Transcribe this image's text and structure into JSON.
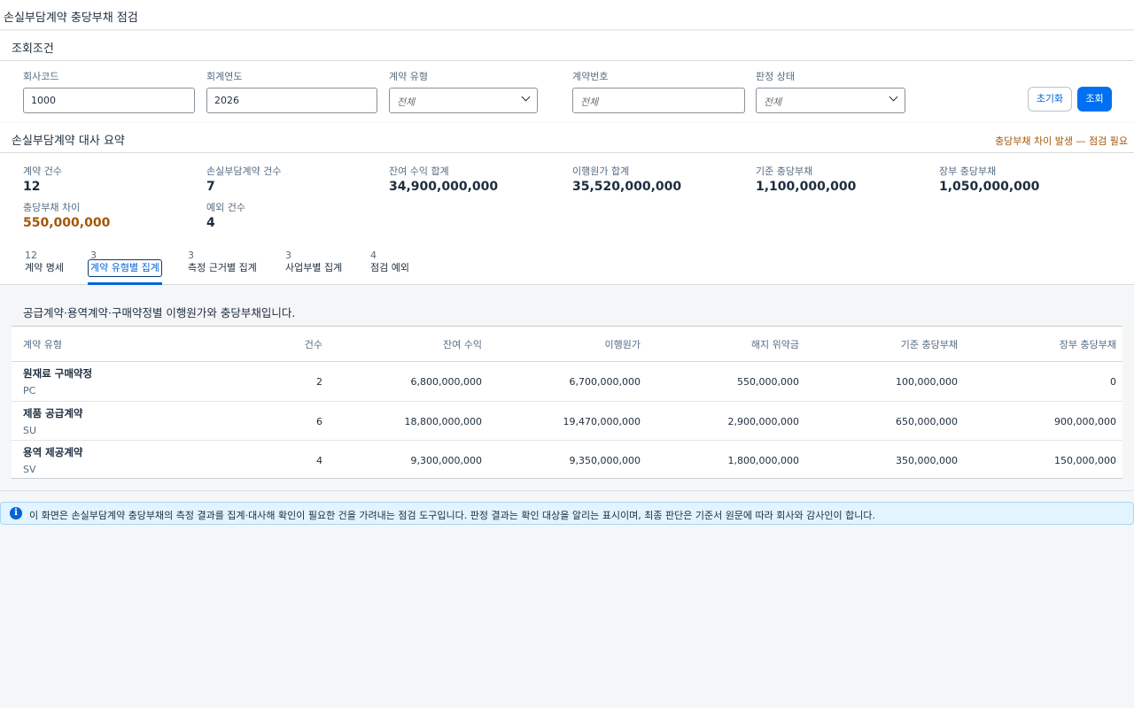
{
  "app_title": "손실부담계약 충당부채 점검",
  "filters": {
    "title": "조회조건",
    "company_code": {
      "label": "회사코드",
      "value": "1000"
    },
    "fiscal_year": {
      "label": "회계연도",
      "value": "2026"
    },
    "contract_type": {
      "label": "계약 유형",
      "value": "전체"
    },
    "contract_no": {
      "label": "계약번호",
      "placeholder": "전체"
    },
    "judgment_status": {
      "label": "판정 상태",
      "value": "전체"
    },
    "reset_label": "초기화",
    "search_label": "조회"
  },
  "summary": {
    "title": "손실부담계약 대사 요약",
    "alert": "충당부채 차이 발생 — 점검 필요",
    "kpis": [
      {
        "label": "계약 건수",
        "value": "12"
      },
      {
        "label": "손실부담계약 건수",
        "value": "7"
      },
      {
        "label": "잔여 수익 합계",
        "value": "34,900,000,000"
      },
      {
        "label": "이행원가 합계",
        "value": "35,520,000,000"
      },
      {
        "label": "기준 충당부채",
        "value": "1,100,000,000"
      },
      {
        "label": "장부 충당부채",
        "value": "1,050,000,000"
      },
      {
        "label": "충당부채 차이",
        "value": "550,000,000"
      },
      {
        "label": "예외 건수",
        "value": "4"
      }
    ]
  },
  "tabs": [
    {
      "count": "12",
      "label": "계약 명세"
    },
    {
      "count": "3",
      "label": "계약 유형별 집계"
    },
    {
      "count": "3",
      "label": "측정 근거별 집계"
    },
    {
      "count": "3",
      "label": "사업부별 집계"
    },
    {
      "count": "4",
      "label": "점검 예외"
    }
  ],
  "active_tab": 1,
  "description": "공급계약·용역계약·구매약정별 이행원가와 충당부채입니다.",
  "table": {
    "columns": [
      "계약 유형",
      "건수",
      "잔여 수익",
      "이행원가",
      "해지 위약금",
      "기준 충당부채",
      "장부 충당부채"
    ],
    "rows": [
      {
        "name": "원재료 구매약정",
        "code": "PC",
        "count": "2",
        "revenue": "6,800,000,000",
        "cost": "6,700,000,000",
        "penalty": "550,000,000",
        "std_provision": "100,000,000",
        "book_provision": "0"
      },
      {
        "name": "제품 공급계약",
        "code": "SU",
        "count": "6",
        "revenue": "18,800,000,000",
        "cost": "19,470,000,000",
        "penalty": "2,900,000,000",
        "std_provision": "650,000,000",
        "book_provision": "900,000,000"
      },
      {
        "name": "용역 제공계약",
        "code": "SV",
        "count": "4",
        "revenue": "9,300,000,000",
        "cost": "9,350,000,000",
        "penalty": "1,800,000,000",
        "std_provision": "350,000,000",
        "book_provision": "150,000,000"
      }
    ]
  },
  "info_message": "이 화면은 손실부담계약 충당부채의 측정 결과를 집계·대사해 확인이 필요한 건을 가려내는 점검 도구입니다. 판정 결과는 확인 대상을 알리는 표시이며, 최종 판단은 기준서 원문에 따라 회사와 감사인이 합니다.",
  "colors": {
    "accent": "#0070f2",
    "warning": "#a45709",
    "info_bg": "#e1f4ff"
  }
}
